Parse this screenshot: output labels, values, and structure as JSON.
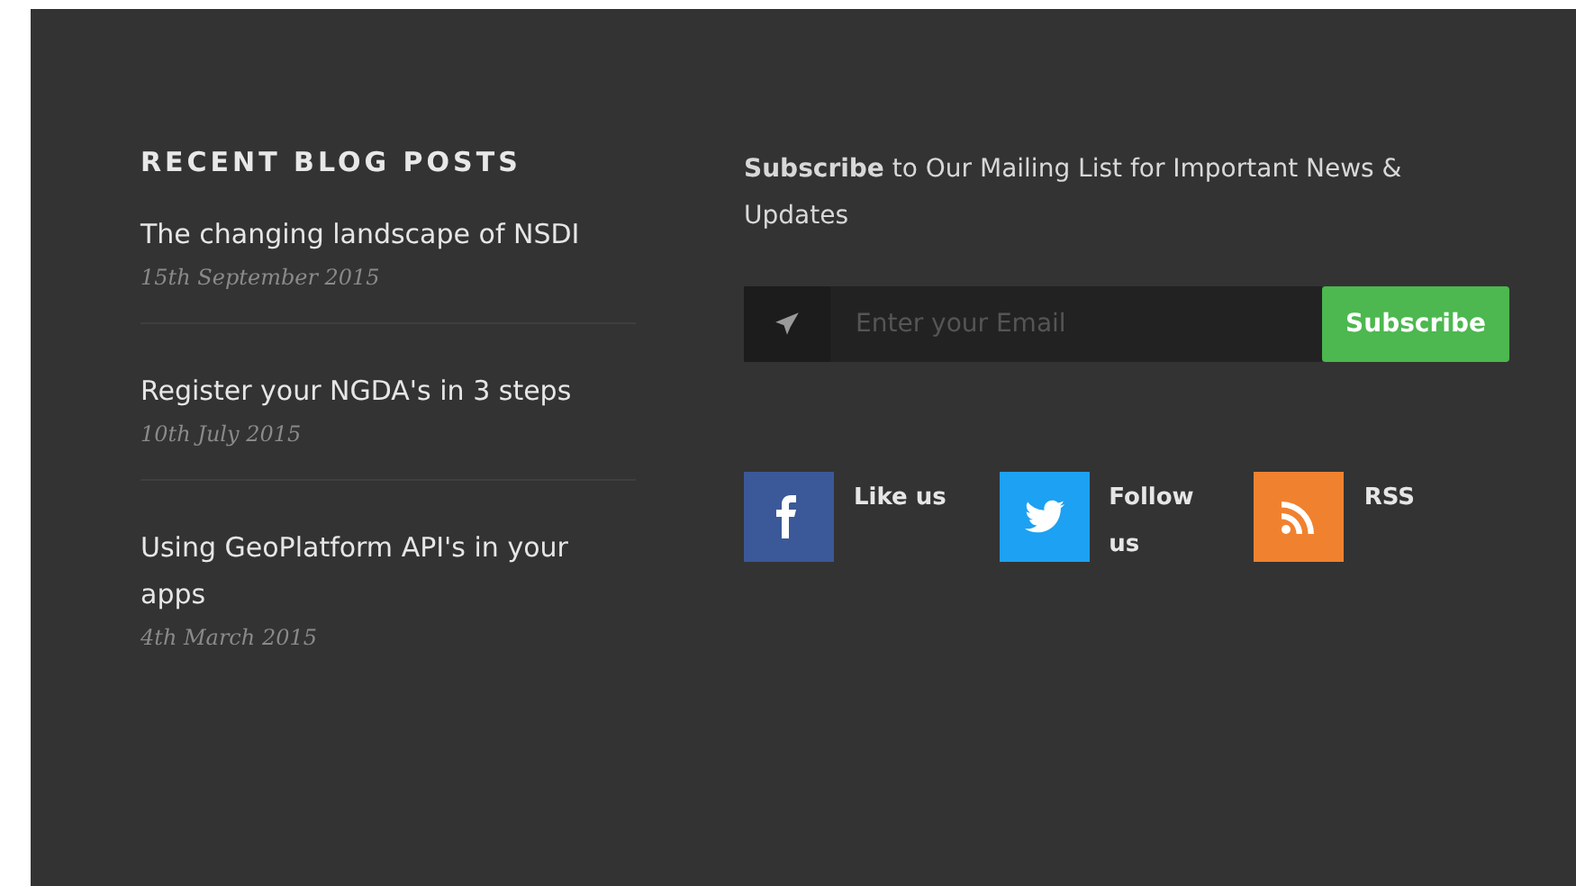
{
  "recent_posts": {
    "heading": "RECENT BLOG POSTS",
    "posts": [
      {
        "title": "The changing landscape of NSDI",
        "date": "15th September 2015"
      },
      {
        "title": "Register your NGDA's in 3 steps",
        "date": "10th July 2015"
      },
      {
        "title": "Using GeoPlatform API's in your apps",
        "date": "4th March 2015"
      }
    ]
  },
  "newsletter": {
    "text": "**Subscribe** to Our Mailing List for Important News & Updates",
    "placeholder": "Enter your Email",
    "button": "Subscribe"
  },
  "social": [
    {
      "kind": "facebook",
      "label": "Like us"
    },
    {
      "kind": "twitter",
      "label": "Follow us"
    },
    {
      "kind": "rss",
      "label": "RSS"
    }
  ]
}
